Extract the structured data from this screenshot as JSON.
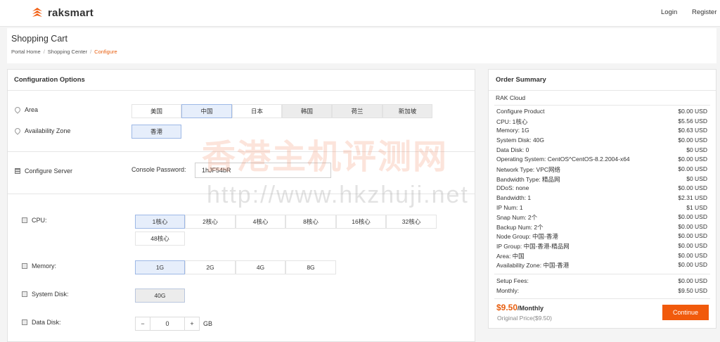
{
  "brand": {
    "name": "raksmart",
    "color": "#f15a0c"
  },
  "topnav": {
    "login": "Login",
    "register": "Register"
  },
  "page": {
    "title": "Shopping Cart",
    "breadcrumb": [
      "Portal Home",
      "Shopping Center",
      "Configure"
    ]
  },
  "config": {
    "title": "Configuration Options",
    "area_label": "Area",
    "areas": [
      "美国",
      "中国",
      "日本",
      "韩国",
      "荷兰",
      "新加坡"
    ],
    "area_selected": "中国",
    "zone_label": "Availability Zone",
    "zones": [
      "香港"
    ],
    "server_label": "Configure Server",
    "password_label": "Console Password:",
    "password_value": "1hJF54bR",
    "cpu_label": "CPU:",
    "cpus": [
      "1核心",
      "2核心",
      "4核心",
      "8核心",
      "16核心",
      "32核心",
      "48核心"
    ],
    "memory_label": "Memory:",
    "memories": [
      "1G",
      "2G",
      "4G",
      "8G"
    ],
    "disk_label": "System Disk:",
    "disks": [
      "40G"
    ],
    "datadisk_label": "Data Disk:",
    "datadisk": {
      "minus": "−",
      "value": "0",
      "plus": "+",
      "unit": "GB"
    }
  },
  "summary": {
    "title": "Order Summary",
    "product": "RAK Cloud",
    "lines": [
      {
        "label": "Configure Product",
        "price": "$0.00 USD"
      },
      {
        "label": "CPU: 1核心",
        "price": "$5.56 USD"
      },
      {
        "label": "Memory: 1G",
        "price": "$0.63 USD"
      },
      {
        "label": "System Disk: 40G",
        "price": "$0.00 USD"
      },
      {
        "label": "Data Disk: 0",
        "price": "$0 USD"
      },
      {
        "label": "Operating System: CentOS^CentOS-8.2.2004-x64",
        "price": "$0.00 USD"
      },
      {
        "label": "Network Type: VPC网络",
        "price": "$0.00 USD"
      },
      {
        "label": "Bandwidth Type: 精品网",
        "price": "$0 USD"
      },
      {
        "label": "DDoS: none",
        "price": "$0.00 USD"
      },
      {
        "label": "Bandwidth: 1",
        "price": "$2.31 USD"
      },
      {
        "label": "IP Num: 1",
        "price": "$1 USD"
      },
      {
        "label": "Snap Num: 2个",
        "price": "$0.00 USD"
      },
      {
        "label": "Backup Num: 2个",
        "price": "$0.00 USD"
      },
      {
        "label": "Node Group: 中国-香港",
        "price": "$0.00 USD"
      },
      {
        "label": "IP Group: 中国-香港-精品网",
        "price": "$0.00 USD"
      },
      {
        "label": "Area: 中国",
        "price": "$0.00 USD"
      },
      {
        "label": "Availability Zone: 中国-香港",
        "price": "$0.00 USD"
      }
    ],
    "setup_label": "Setup Fees:",
    "setup_price": "$0.00 USD",
    "monthly_label": "Monthly:",
    "monthly_price": "$9.50 USD",
    "total": "$9.50",
    "total_period": "/Monthly",
    "original": "Original Price($9.50)",
    "continue": "Continue"
  },
  "watermark": {
    "cn": "香港主机评测网",
    "url": "http://www.hkzhuji.net"
  }
}
